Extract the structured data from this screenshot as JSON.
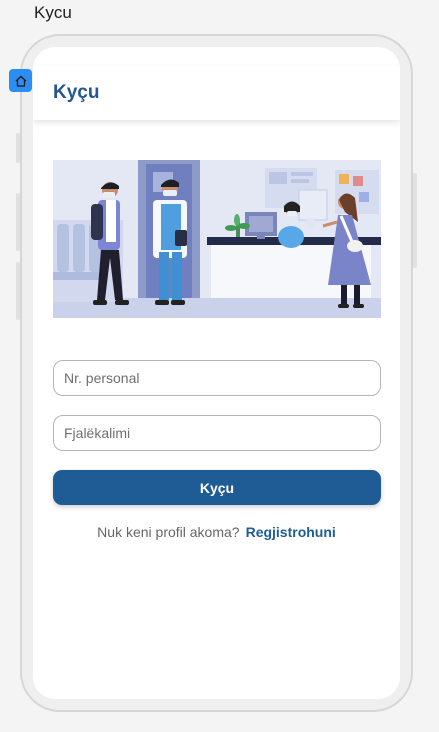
{
  "window": {
    "title": "Kycu"
  },
  "header": {
    "title": "Kyçu"
  },
  "icons": {
    "home": "home-icon"
  },
  "form": {
    "personal_number": {
      "placeholder": "Nr. personal",
      "value": ""
    },
    "password": {
      "placeholder": "Fjalëkalimi",
      "value": ""
    },
    "login_label": "Kyçu"
  },
  "register": {
    "prompt": "Nuk keni profil akoma?",
    "link": "Regjistrohuni"
  },
  "colors": {
    "brand": "#1f5c96",
    "header_text": "#22578f",
    "badge": "#2b8ef0"
  }
}
